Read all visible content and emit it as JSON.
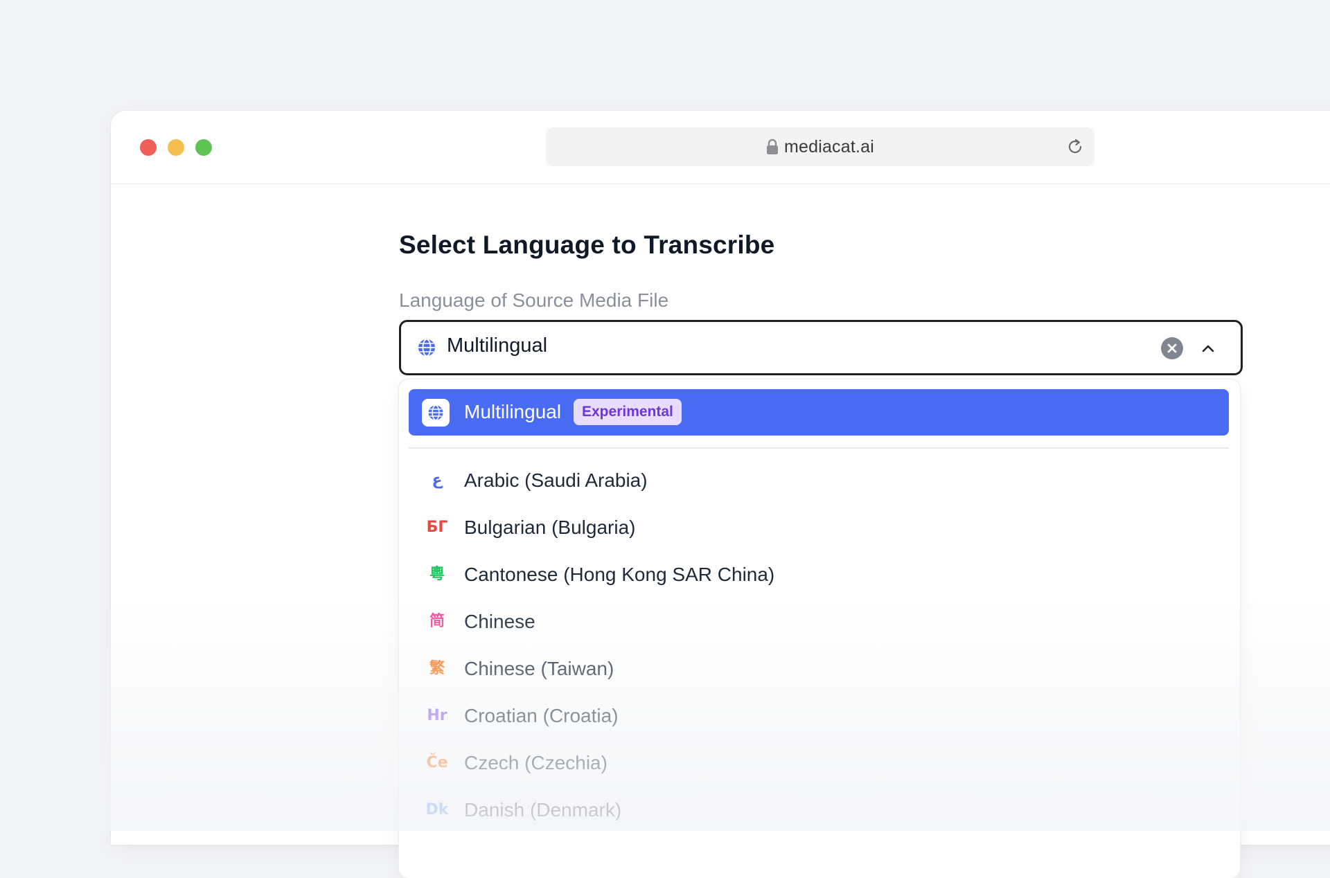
{
  "browser": {
    "url": "mediacat.ai"
  },
  "page": {
    "title": "Select Language to Transcribe",
    "field_label": "Language of Source Media File"
  },
  "select": {
    "value": "Multilingual"
  },
  "dropdown": {
    "selected": {
      "label": "Multilingual",
      "badge": "Experimental"
    },
    "options": [
      {
        "glyph": "ع",
        "label": "Arabic (Saudi Arabia)",
        "color": "#4a6cf2"
      },
      {
        "glyph": "БГ",
        "label": "Bulgarian (Bulgaria)",
        "color": "#ef4444"
      },
      {
        "glyph": "粵",
        "label": "Cantonese (Hong Kong SAR China)",
        "color": "#22c55e"
      },
      {
        "glyph": "简",
        "label": "Chinese",
        "color": "#ec4899"
      },
      {
        "glyph": "繁",
        "label": "Chinese (Taiwan)",
        "color": "#f97316"
      },
      {
        "glyph": "Hr",
        "label": "Croatian (Croatia)",
        "color": "#8b5cf6"
      },
      {
        "glyph": "Če",
        "label": "Czech (Czechia)",
        "color": "#f97316"
      },
      {
        "glyph": "Dk",
        "label": "Danish (Denmark)",
        "color": "#3b82f6"
      }
    ]
  },
  "colors": {
    "accent": "#4a6cf2",
    "badge_bg": "#e9ddff",
    "badge_text": "#6c35de"
  }
}
